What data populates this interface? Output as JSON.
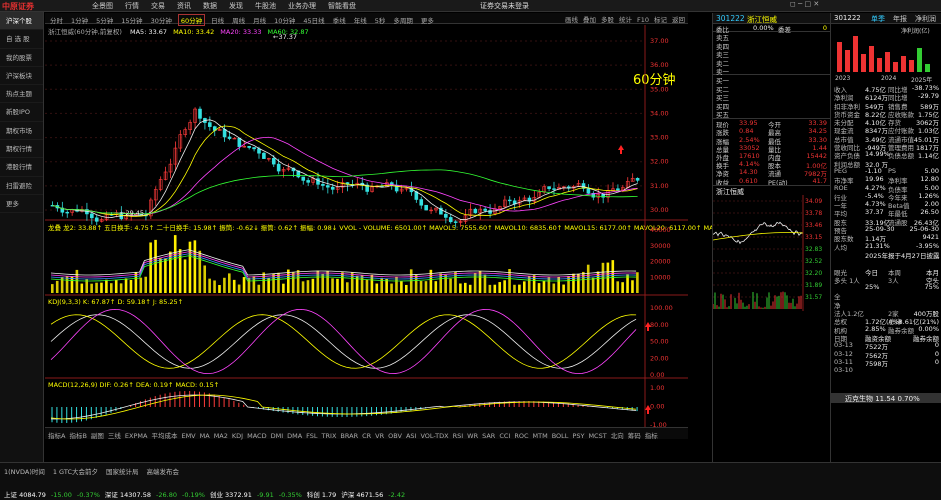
{
  "app": {
    "logo": "中原证券",
    "hint": "证券交易未登录",
    "clock": "22:20:40"
  },
  "menu": [
    "全景图",
    "行情",
    "交易",
    "资讯",
    "数据",
    "发现",
    "牛股池",
    "业务办理",
    "智能看盘"
  ],
  "sidebar": [
    "沪深个股",
    "自 选 股",
    "我的股票",
    "沪深板块",
    "热点主题",
    "新股IPO",
    "期权市场",
    "期权行情",
    "港股行情",
    "扫雷避险",
    "更多"
  ],
  "periods": [
    "分时",
    "1分钟",
    "5分钟",
    "15分钟",
    "30分钟",
    "60分钟",
    "日线",
    "周线",
    "月线",
    "10分钟",
    "45日线",
    "季线",
    "年线",
    "5秒",
    "多周期",
    "更多"
  ],
  "active_period": "60分钟",
  "tools": [
    "画线",
    "叠加",
    "多股",
    "统计",
    "F10",
    "标记",
    "返回"
  ],
  "main": {
    "stock_title": "浙江恒威(60分钟,前复权)",
    "ma": [
      {
        "t": "MA5: 33.67",
        "c": "#eeeeee"
      },
      {
        "t": "MA10: 33.42",
        "c": "#ffff00"
      },
      {
        "t": "MA20: 33.33",
        "c": "#ff44ff"
      },
      {
        "t": "MA60: 32.87",
        "c": "#33ff33"
      }
    ],
    "overlay": "60分钟",
    "high_label": "37.37",
    "low_label": "29.45",
    "y_ticks": [
      "37.00",
      "36.00",
      "35.00",
      "34.00",
      "33.00",
      "32.00",
      "31.00",
      "30.00"
    ],
    "vol_title": "龙叠 龙2: 33.88↑  五日换手: 4.75↑  二十日换手: 15.98↑  振筒: -0.62↓  振筒: 0.62↑  振幅: 0.98↓  VVOL - VOLUME: 6501.00↑  MAVOL5: 7555.60↑  MAVOL10: 6835.60↑  MAVOL15: 6177.00↑  MAVOL20: 6117.00↑  MAVOL60: 6554.73",
    "vol_ticks": [
      "40000",
      "30000",
      "20000",
      "10000"
    ],
    "kdj_title": "KDJ(9,3,3)  K: 67.87↑  D: 59.18↑  J: 85.25↑",
    "kdj_ticks": [
      "100.00",
      "80.00",
      "50.00",
      "20.00",
      "0.00"
    ],
    "macd_title": "MACD(12,26,9)  DIF: 0.26↑  DEA: 0.19↑  MACD: 0.15↑",
    "macd_ticks": [
      "1.00",
      "0.00",
      "-1.00"
    ],
    "x_labels": [
      "01月26日",
      "14:00",
      "11:00",
      "14:00",
      "11:00",
      "14:00",
      "11:00",
      "14:00",
      "11:00",
      "14:00",
      "11:00",
      "14:00",
      "11:00",
      "14:00",
      "15:00"
    ],
    "freq": "60分钟"
  },
  "indicators": [
    "指标A",
    "指标B",
    "副图",
    "三线",
    "EXPMA",
    "平均成本",
    "EMV",
    "MA",
    "MA2",
    "KDJ",
    "MACD",
    "DMI",
    "DMA",
    "FSL",
    "TRIX",
    "BRAR",
    "CR",
    "VR",
    "OBV",
    "ASI",
    "VOL-TDX",
    "RSI",
    "WR",
    "SAR",
    "CCI",
    "ROC",
    "MTM",
    "BOLL",
    "PSY",
    "MCST",
    "北向",
    "筹码",
    "指标"
  ],
  "quote": {
    "code": "301222",
    "name": "浙江恒威",
    "wb_label": "委比",
    "wb": "0.00%",
    "wc_label": "委差",
    "wc": "0",
    "asks": [
      {
        "l": "卖五",
        "p": "",
        "v": ""
      },
      {
        "l": "卖四",
        "p": "",
        "v": ""
      },
      {
        "l": "卖三",
        "p": "",
        "v": ""
      },
      {
        "l": "卖二",
        "p": "",
        "v": ""
      },
      {
        "l": "卖一",
        "p": "",
        "v": ""
      }
    ],
    "bids": [
      {
        "l": "买一",
        "p": "",
        "v": ""
      },
      {
        "l": "买二",
        "p": "",
        "v": ""
      },
      {
        "l": "买三",
        "p": "",
        "v": ""
      },
      {
        "l": "买四",
        "p": "",
        "v": ""
      },
      {
        "l": "买五",
        "p": "",
        "v": ""
      }
    ],
    "stats": [
      {
        "a": "现价",
        "b": "33.95",
        "c": "今开",
        "d": "33.39"
      },
      {
        "a": "涨跌",
        "b": "0.84",
        "c": "最高",
        "d": "34.25"
      },
      {
        "a": "涨幅",
        "b": "2.54%",
        "c": "最低",
        "d": "33.30"
      },
      {
        "a": "总量",
        "b": "33052",
        "c": "量比",
        "d": "1.44"
      },
      {
        "a": "外盘",
        "b": "17610",
        "c": "内盘",
        "d": "15442"
      },
      {
        "a": "换手",
        "b": "4.14%",
        "c": "股本",
        "d": "1.00亿"
      },
      {
        "a": "净资",
        "b": "14.30",
        "c": "流通",
        "d": "7982万"
      },
      {
        "a": "收益",
        "b": "0.610",
        "c": "PE(动)",
        "d": "41.7"
      }
    ],
    "name2": "浙江恒威",
    "mini_ticks": [
      "34.09",
      "33.78",
      "33.46",
      "33.15",
      "32.83",
      "32.52",
      "32.20",
      "31.89",
      "31.57"
    ]
  },
  "fin": {
    "code": "301222",
    "tabs": [
      "单季",
      "年报",
      "净利润"
    ],
    "profit_label": "净利润(亿)",
    "years": [
      "2023",
      "2024",
      "2025年"
    ],
    "rows": [
      {
        "a": "收入",
        "b": "4.75亿",
        "c": "同比增",
        "d": "-38.73%"
      },
      {
        "a": "净利润",
        "b": "6124万",
        "c": "同比增",
        "d": "-29.79"
      },
      {
        "a": "扣非净利",
        "b": "549万",
        "c": "销售费",
        "d": "589万"
      },
      {
        "a": "货币资金",
        "b": "8.22亿",
        "c": "应收账款",
        "d": "1.75亿"
      },
      {
        "a": "未分配",
        "b": "4.10亿",
        "c": "存货",
        "d": "3062万"
      },
      {
        "a": "现金流",
        "b": "8347万",
        "c": "应付账款",
        "d": "1.03亿"
      },
      {
        "a": "总市值",
        "b": "3.49亿",
        "c": "流通市值",
        "d": "45.01万"
      },
      {
        "a": "营收同比",
        "b": "-949万",
        "c": "管理费用",
        "d": "1817万"
      },
      {
        "a": "资产负债",
        "b": "14.99%",
        "c": "负债总额",
        "d": "1.14亿"
      },
      {
        "a": "利润总额",
        "b": "32.0 万",
        "c": "",
        "d": ""
      },
      {
        "a": "PEG",
        "b": "-1.10",
        "c": "PS",
        "d": "5.00"
      },
      {
        "a": "市净率",
        "b": "19.96",
        "c": "净利率",
        "d": "12.80"
      },
      {
        "a": "ROE",
        "b": "4.27%",
        "c": "负债率",
        "d": "5.00"
      },
      {
        "a": "行业",
        "b": "-5.4%",
        "c": "今年来",
        "d": "1.26%"
      },
      {
        "a": "一年",
        "b": "4.73%",
        "c": "Beta值",
        "d": "2.00"
      },
      {
        "a": "平均",
        "b": "37.37",
        "c": "年最低",
        "d": "26.50"
      },
      {
        "a": "股东",
        "b": "33.19亿",
        "c": "流通股",
        "d": "26.43亿"
      },
      {
        "a": "预告",
        "b": "25-09-30",
        "c": "",
        "d": "25-06-30"
      },
      {
        "a": "股东数",
        "b": "1.14万",
        "c": "",
        "d": "9421"
      },
      {
        "a": "人均",
        "b": "21.31%",
        "c": "",
        "d": "-3.95%"
      },
      {
        "a": "",
        "b": "2025年报于4月27日披露",
        "c": "",
        "d": ""
      },
      {
        "a": "",
        "b": "",
        "c": "",
        "d": ""
      },
      {
        "a": "眼光",
        "b": "今日",
        "c": "本周",
        "d": "本月"
      },
      {
        "a": "多头 1人",
        "b": "",
        "c": "3人",
        "d": "空头"
      },
      {
        "a": "",
        "b": "25%",
        "c": "",
        "d": "75%"
      },
      {
        "a": "全",
        "b": "",
        "c": "",
        "d": ""
      },
      {
        "a": "净",
        "b": "",
        "c": "",
        "d": ""
      },
      {
        "a": "法人1.2亿",
        "b": "",
        "c": "2家",
        "d": "400万股"
      },
      {
        "a": "总权",
        "b": "1.72亿(4%)",
        "c": "总计",
        "d": "8.61亿(21%)"
      },
      {
        "a": "机构",
        "b": "2.85%",
        "c": "融券余额",
        "d": "0.00%"
      },
      {
        "a": "日期",
        "b": "融资余额",
        "c": "",
        "d": "融券余额"
      },
      {
        "a": "03-13",
        "b": "7522万",
        "c": "",
        "d": "0"
      },
      {
        "a": "03-12",
        "b": "7562万",
        "c": "",
        "d": "0"
      },
      {
        "a": "03-11",
        "b": "7598万",
        "c": "",
        "d": "0"
      },
      {
        "a": "03-10",
        "b": "",
        "c": "",
        "d": ""
      }
    ],
    "headline": "迈克生物 11.54  0.70%"
  },
  "bottom": {
    "row1": [
      "1(NVDA)时间",
      "1 GTC大会前夕",
      "国家统计局",
      "高端发布会"
    ],
    "row2": [
      {
        "t": "上证 4084.79",
        "c": "#ffffff"
      },
      {
        "t": "-15.00",
        "c": "#33cc33"
      },
      {
        "t": "-0.37%",
        "c": "#33cc33"
      },
      {
        "t": "深证 14307.58",
        "c": "#ffffff"
      },
      {
        "t": "-26.80",
        "c": "#33cc33"
      },
      {
        "t": "-0.19%",
        "c": "#33cc33"
      },
      {
        "t": "创业 3372.91",
        "c": "#ffffff"
      },
      {
        "t": "-9.91",
        "c": "#33cc33"
      },
      {
        "t": "-0.35%",
        "c": "#33cc33"
      },
      {
        "t": "科创 1.79",
        "c": "#ffffff"
      },
      {
        "t": "沪深 4671.56",
        "c": "#ffffff"
      },
      {
        "t": "-2.42",
        "c": "#33cc33"
      }
    ]
  }
}
